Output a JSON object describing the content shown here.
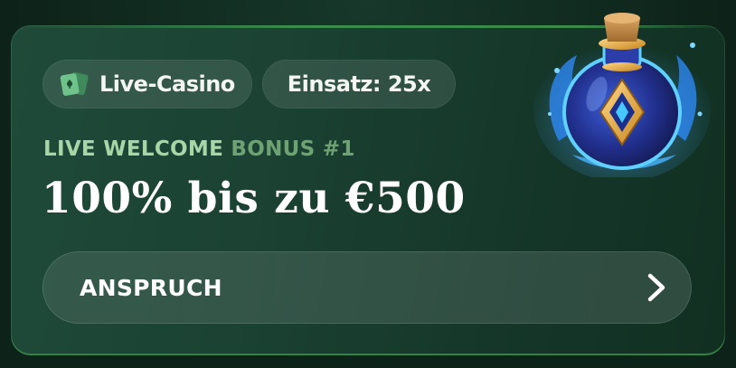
{
  "card": {
    "category_chip": {
      "label": "Live-Casino",
      "icon": "playing-cards-icon"
    },
    "stake_chip": {
      "label": "Einsatz: 25x"
    },
    "eyebrow": {
      "part_1": "LIVE WELCOME",
      "part_2": "BONUS #1"
    },
    "headline": "100% bis zu €500",
    "claim_button": {
      "label": "ANSPRUCH",
      "icon": "chevron-right-icon"
    },
    "illustration": "magic-potion-icon"
  },
  "colors": {
    "card_background": "#1b4233",
    "accent_green": "#a9d6a6",
    "eyebrow_dim": "#6fa273",
    "text": "#ffffff"
  }
}
